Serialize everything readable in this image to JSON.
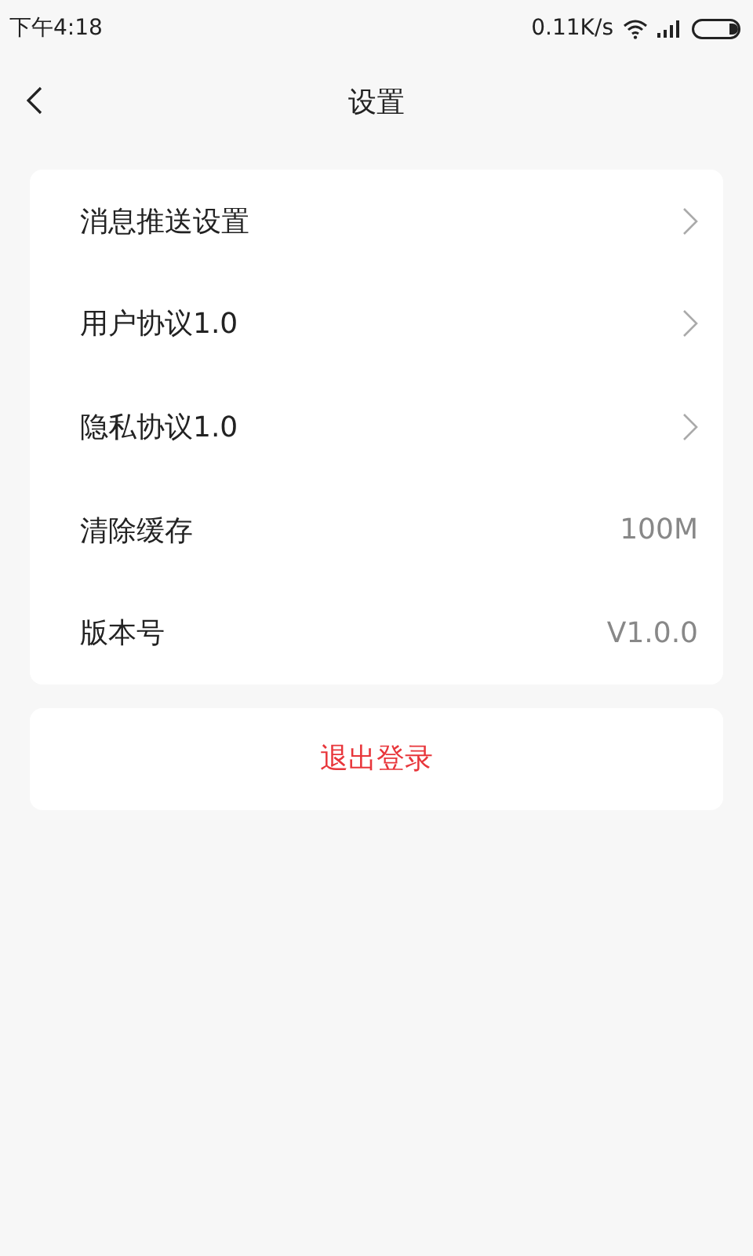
{
  "status_bar": {
    "time": "下午4:18",
    "speed": "0.11K/s"
  },
  "header": {
    "title": "设置"
  },
  "settings": [
    {
      "kind": "link",
      "label": "消息推送设置"
    },
    {
      "kind": "link",
      "label": "用户协议1.0"
    },
    {
      "kind": "link",
      "label": "隐私协议1.0"
    },
    {
      "kind": "value",
      "label": "清除缓存",
      "value": "100M"
    },
    {
      "kind": "value",
      "label": "版本号",
      "value": "V1.0.0"
    }
  ],
  "logout": {
    "label": "退出登录"
  }
}
